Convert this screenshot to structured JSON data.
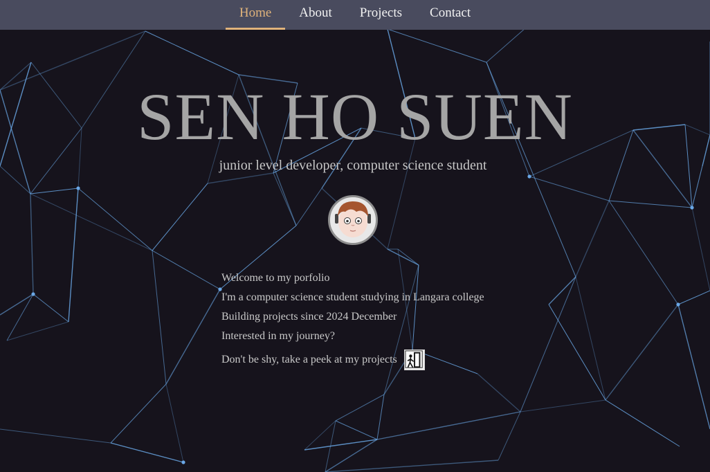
{
  "nav": {
    "items": [
      {
        "label": "Home",
        "active": true
      },
      {
        "label": "About",
        "active": false
      },
      {
        "label": "Projects",
        "active": false
      },
      {
        "label": "Contact",
        "active": false
      }
    ]
  },
  "hero": {
    "title": "SEN HO SUEN",
    "subtitle": "junior level developer, computer science student",
    "avatar_icon": "cartoon-face-avatar"
  },
  "intro": {
    "lines": [
      "Welcome to my porfolio",
      "I'm a computer science student studying in Langara college",
      "Building projects since 2024 December",
      "Interested in my journey?"
    ],
    "peek_text": "Don't be shy, take a peek at my projects",
    "peek_icon": "door-icon"
  },
  "colors": {
    "background": "#16131c",
    "navbar": "#494b5e",
    "accent": "#e0b37b",
    "network_line": "#6aa7e6",
    "title": "#a5a5a5"
  }
}
